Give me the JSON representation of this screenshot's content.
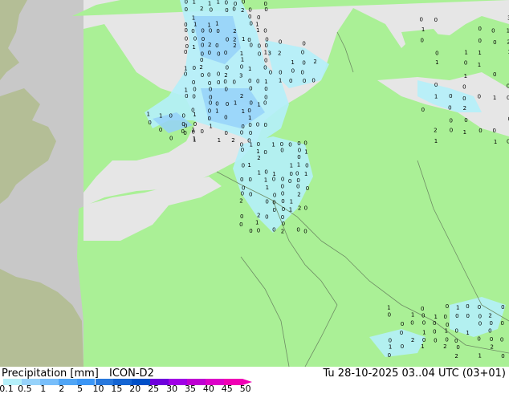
{
  "title": {
    "left_label": "Precipitation [mm]",
    "model": "ICON-D2",
    "valid_time": "Tu 28-10-2025 03..04 UTC (03+01)"
  },
  "legend": {
    "ticks": [
      "0.1",
      "0.5",
      "1",
      "2",
      "5",
      "10",
      "15",
      "20",
      "25",
      "30",
      "35",
      "40",
      "45",
      "50"
    ],
    "colors": [
      "#b4f0fa",
      "#96d2fa",
      "#78befa",
      "#50a5f5",
      "#3c96f5",
      "#2878dc",
      "#1464d2",
      "#0050c8",
      "#6e00dc",
      "#a000e6",
      "#be00d2",
      "#dc00c8",
      "#f000b4"
    ]
  },
  "map": {
    "colors": {
      "land": "#aaf096",
      "sea": "#e6e6e6",
      "outside_domain": "#c8c8c8",
      "outside_land": "#b4be96",
      "precip_light": "#b4f0fa",
      "precip_medium": "#96d2fa",
      "border": "#6e8c64"
    },
    "value_markers": [
      "0",
      "1",
      "2",
      "3"
    ]
  }
}
